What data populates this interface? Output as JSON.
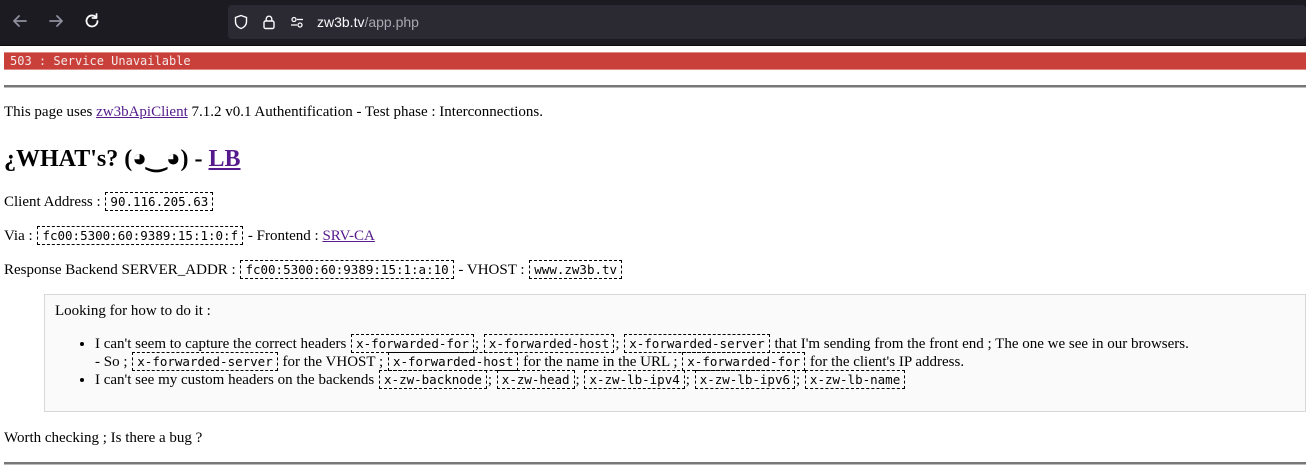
{
  "browser": {
    "url_host": "zw3b.tv",
    "url_path": "/app.php",
    "icons": [
      "back-icon",
      "forward-icon",
      "reload-icon",
      "shield-icon",
      "lock-icon",
      "permissions-icon"
    ]
  },
  "error_bar": {
    "text": "503 : Service Unavailable"
  },
  "intro": {
    "prefix": "This page uses",
    "link": "zw3bApiClient",
    "suffix": "7.1.2 v0.1 Authentification - Test phase : Interconnections."
  },
  "title": {
    "text": "¿WHAT's? (◕‿◕) -",
    "link": "LB"
  },
  "client": {
    "label": "Client Address :",
    "value": "90.116.205.63"
  },
  "via": {
    "label": "Via :",
    "value": "fc00:5300:60:9389:15:1:0:f",
    "frontend_label": "- Frontend :",
    "frontend_link": "SRV-CA"
  },
  "backend": {
    "label": "Response Backend SERVER_ADDR :",
    "value": "fc00:5300:60:9389:15:1:a:10",
    "vhost_label": "- VHOST :",
    "vhost_value": "www.zw3b.tv"
  },
  "box": {
    "heading": "Looking for how to do it :",
    "item1": {
      "prefix": "I can't seem to capture the correct headers",
      "h1": "x-forwarded-for",
      "sep1": ";",
      "h2": "x-forwarded-host",
      "sep2": ";",
      "h3": "x-forwarded-server",
      "suffix": "that I'm sending from the front end ; The one we see in our browsers.",
      "line2_prefix": "- So ;",
      "h4": "x-forwarded-server",
      "t1": "for the VHOST ;",
      "h5": "x-forwarded-host",
      "t2": "for the name in the URL ;",
      "h6": "x-forwarded-for",
      "t3": "for the client's IP address."
    },
    "item2": {
      "prefix": "I can't see my custom headers on the backends",
      "h1": "x-zw-backnode",
      "sep": ";",
      "h2": "x-zw-head",
      "h3": "x-zw-lb-ipv4",
      "h4": "x-zw-lb-ipv6",
      "h5": "x-zw-lb-name"
    }
  },
  "footer": {
    "text": "Worth checking ; Is there a bug ?"
  },
  "colors": {
    "error_bg": "#c9403a",
    "link": "#551a8b",
    "chrome_bg": "#1c1b22"
  }
}
